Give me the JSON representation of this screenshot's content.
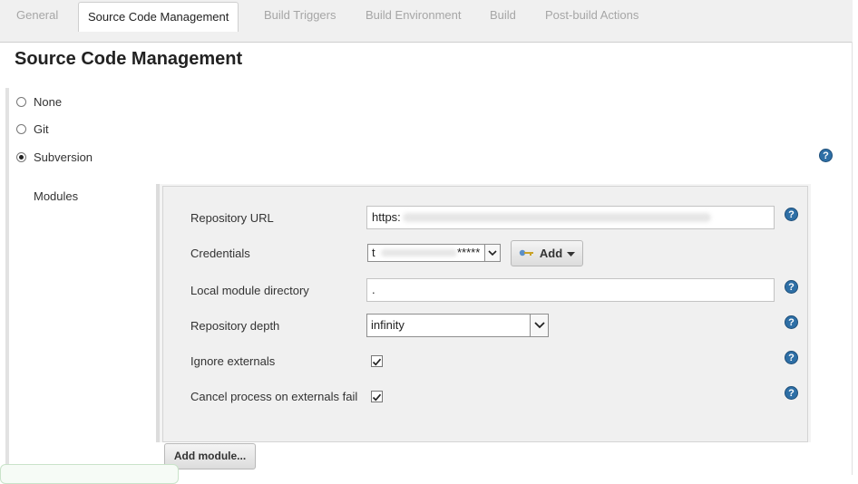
{
  "tabs": [
    {
      "label": "General",
      "active": false
    },
    {
      "label": "Source Code Management",
      "active": true
    },
    {
      "label": "Build Triggers",
      "active": false
    },
    {
      "label": "Build Environment",
      "active": false
    },
    {
      "label": "Build",
      "active": false
    },
    {
      "label": "Post-build Actions",
      "active": false
    }
  ],
  "section_title": "Source Code Management",
  "scm_options": [
    {
      "label": "None",
      "selected": false
    },
    {
      "label": "Git",
      "selected": false
    },
    {
      "label": "Subversion",
      "selected": true
    }
  ],
  "modules": {
    "label": "Modules",
    "repository_url": {
      "label": "Repository URL",
      "value": "https:"
    },
    "credentials": {
      "label": "Credentials",
      "value_prefix": "t",
      "value_suffix": "*****"
    },
    "add_button": {
      "label": "Add"
    },
    "local_module_directory": {
      "label": "Local module directory",
      "value": "."
    },
    "repository_depth": {
      "label": "Repository depth",
      "value": "infinity"
    },
    "ignore_externals": {
      "label": "Ignore externals",
      "checked": true
    },
    "cancel_process": {
      "label": "Cancel process on externals fail",
      "checked": true
    },
    "add_module_button": "Add module..."
  },
  "help_icon_glyph": "?",
  "colors": {
    "help_icon": "#2e6fa6",
    "tab_bar": "#f0f0f0",
    "module_panel": "#f0f0f0"
  }
}
